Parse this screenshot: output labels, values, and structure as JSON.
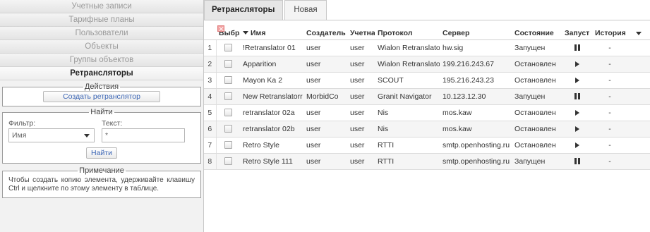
{
  "sidebar": {
    "nav": [
      {
        "label": "Учетные записи",
        "active": false
      },
      {
        "label": "Тарифные планы",
        "active": false
      },
      {
        "label": "Пользователи",
        "active": false
      },
      {
        "label": "Объекты",
        "active": false
      },
      {
        "label": "Группы объектов",
        "active": false
      },
      {
        "label": "Ретрансляторы",
        "active": true
      }
    ],
    "actions": {
      "legend": "Действия",
      "create_button": "Создать ретранслятор"
    },
    "find": {
      "legend": "Найти",
      "filter_label": "Фильтр:",
      "text_label": "Текст:",
      "filter_value": "Имя",
      "text_value": "*",
      "find_button": "Найти"
    },
    "note": {
      "legend": "Примечание",
      "text": "Чтобы создать копию элемента, удерживайте клавишу Ctrl и щелкните по этому элементу в таблице."
    }
  },
  "tabs": [
    {
      "label": "Ретрансляторы",
      "active": true,
      "closable": true
    },
    {
      "label": "Новая",
      "active": false,
      "closable": false
    }
  ],
  "table": {
    "headers": {
      "select": "Выбра",
      "name": "Имя",
      "creator": "Создатель",
      "account": "Учетна",
      "protocol": "Протокол",
      "server": "Сервер",
      "state": "Состояние",
      "run": "Запуст",
      "history": "История"
    },
    "rows": [
      {
        "num": "1",
        "name": "!Retranslator 01",
        "creator": "user",
        "account": "user",
        "protocol": "Wialon Retranslator",
        "server": "hw.sig",
        "state": "Запущен",
        "run_icon": "pause-icon",
        "history": "-"
      },
      {
        "num": "2",
        "name": "Apparition",
        "creator": "user",
        "account": "user",
        "protocol": "Wialon Retranslator",
        "server": "199.216.243.67",
        "state": "Остановлен",
        "run_icon": "play-icon",
        "history": "-"
      },
      {
        "num": "3",
        "name": "Mayon Ka 2",
        "creator": "user",
        "account": "user",
        "protocol": "SCOUT",
        "server": "195.216.243.23",
        "state": "Остановлен",
        "run_icon": "play-icon",
        "history": "-"
      },
      {
        "num": "4",
        "name": "New Retranslatorr",
        "creator": "MorbidCo",
        "account": "user",
        "protocol": "Granit Navigator",
        "server": "10.123.12.30",
        "state": "Запущен",
        "run_icon": "pause-icon",
        "history": "-"
      },
      {
        "num": "5",
        "name": "retranslator 02a",
        "creator": "user",
        "account": "user",
        "protocol": "Nis",
        "server": "mos.kaw",
        "state": "Остановлен",
        "run_icon": "play-icon",
        "history": "-"
      },
      {
        "num": "6",
        "name": "retranslator 02b",
        "creator": "user",
        "account": "user",
        "protocol": "Nis",
        "server": "mos.kaw",
        "state": "Остановлен",
        "run_icon": "play-icon",
        "history": "-"
      },
      {
        "num": "7",
        "name": "Retro Style",
        "creator": "user",
        "account": "user",
        "protocol": "RTTI",
        "server": "smtp.openhosting.ru",
        "state": "Остановлен",
        "run_icon": "play-icon",
        "history": "-"
      },
      {
        "num": "8",
        "name": "Retro Style 111",
        "creator": "user",
        "account": "user",
        "protocol": "RTTI",
        "server": "smtp.openhosting.ru",
        "state": "Запущен",
        "run_icon": "pause-icon",
        "history": "-"
      }
    ]
  }
}
